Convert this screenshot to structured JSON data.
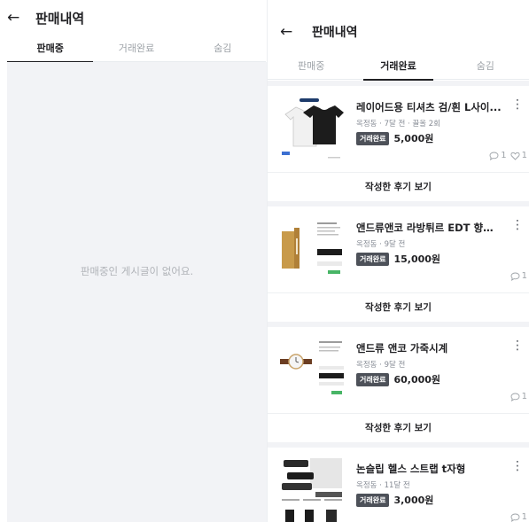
{
  "left_panel": {
    "back_icon": "arrow-left-icon",
    "title": "판매내역",
    "tabs": [
      {
        "label": "판매중",
        "active": true
      },
      {
        "label": "거래완료",
        "active": false
      },
      {
        "label": "숨김",
        "active": false
      }
    ],
    "empty_message": "판매중인 게시글이 없어요."
  },
  "right_panel": {
    "back_icon": "arrow-left-icon",
    "title": "판매내역",
    "tabs": [
      {
        "label": "판매중",
        "active": false
      },
      {
        "label": "거래완료",
        "active": true
      },
      {
        "label": "숨김",
        "active": false
      }
    ],
    "items": [
      {
        "name": "레이어드용 티셔츠 검/흰 L사이...",
        "meta": "옥정동 · 7달 전 · 끌올 2회",
        "status": "거래완료",
        "price": "5,000원",
        "chat_count": "1",
        "like_count": "1",
        "review_label": "작성한 후기 보기"
      },
      {
        "name": "앤드류앤코 라방튀르 EDT 향수 ...",
        "meta": "옥정동 · 9달 전",
        "status": "거래완료",
        "price": "15,000원",
        "chat_count": "1",
        "like_count": "",
        "review_label": "작성한 후기 보기"
      },
      {
        "name": "앤드류 앤코 가죽시계",
        "meta": "옥정동 · 9달 전",
        "status": "거래완료",
        "price": "60,000원",
        "chat_count": "1",
        "like_count": "",
        "review_label": "작성한 후기 보기"
      },
      {
        "name": "논슬립 헬스 스트랩 t자형",
        "meta": "옥정동 · 11달 전",
        "status": "거래완료",
        "price": "3,000원",
        "chat_count": "1",
        "like_count": "",
        "review_label": ""
      }
    ],
    "more_icon": "more-vertical-icon",
    "chat_icon": "chat-bubble-icon",
    "heart_icon": "heart-icon"
  }
}
